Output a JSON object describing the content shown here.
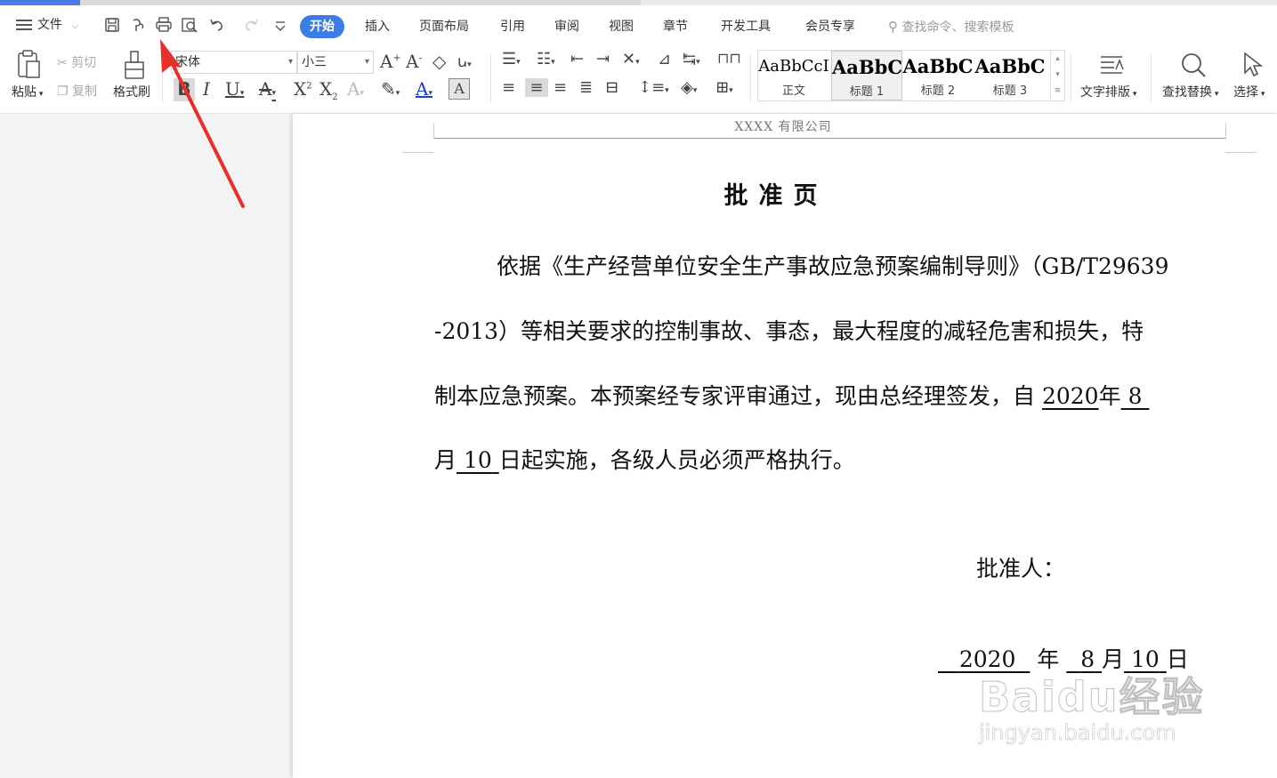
{
  "menu": {
    "file_label": "文件",
    "tabs": [
      "开始",
      "插入",
      "页面布局",
      "引用",
      "审阅",
      "视图",
      "章节",
      "开发工具",
      "会员专享"
    ],
    "active_tab": "开始",
    "search_placeholder": "查找命令、搜索模板"
  },
  "ribbon": {
    "paste": "粘贴",
    "cut": "剪切",
    "copy": "复制",
    "format_painter": "格式刷",
    "font_name": "宋体",
    "font_size": "小三",
    "styles": [
      {
        "sample": "AaBbCcI",
        "name": "正文"
      },
      {
        "sample": "AaBbC",
        "name": "标题 1"
      },
      {
        "sample": "AaBbC",
        "name": "标题 2"
      },
      {
        "sample": "AaBbC",
        "name": "标题 3"
      }
    ],
    "text_layout": "文字排版",
    "find_replace": "查找替换",
    "select": "选择"
  },
  "document": {
    "header": "XXXX 有限公司",
    "title": "批准页",
    "line1": "依据《生产经营单位安全生产事故应急预案编制导则》（GB/T29639",
    "line2": "-2013）等相关要求的控制事故、事态，最大程度的减轻危害和损失，特",
    "line3_pre": "制本应急预案。本预案经专家评审通过，现由总经理签发，自",
    "line3_year": "2020",
    "line3_nian": "年",
    "line3_month": "8",
    "line4_yue": "月",
    "line4_day": "10",
    "line4_rest": "日起实施，各级人员必须严格执行。",
    "approver_label": "批准人：",
    "date_year": "2020",
    "date_nian": "年",
    "date_month": "8",
    "date_yue": "月",
    "date_day": "10",
    "date_ri": "日"
  },
  "watermark": {
    "brand": "Baidu经验",
    "url": "jingyan.baidu.com"
  },
  "colors": {
    "accent": "#3b7de6",
    "annotation_arrow": "#e8302a"
  }
}
